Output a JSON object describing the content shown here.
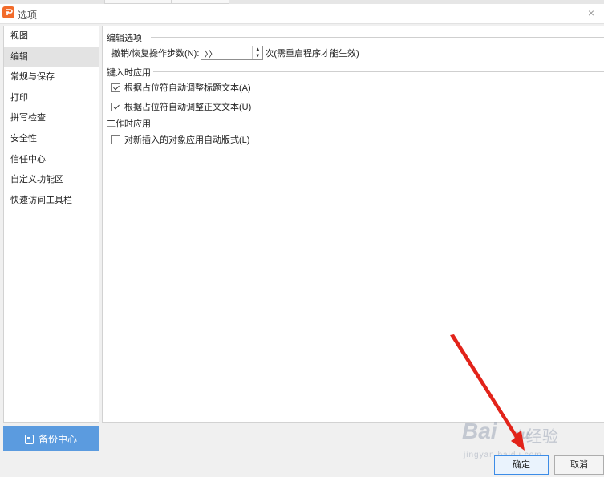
{
  "window": {
    "title": "选项",
    "close_glyph": "×",
    "logo_icon": "wps-logo-icon",
    "accent_color": "#f26b2a"
  },
  "sidebar": {
    "items": [
      {
        "label": "视图"
      },
      {
        "label": "编辑",
        "active": true
      },
      {
        "label": "常规与保存"
      },
      {
        "label": "打印"
      },
      {
        "label": "拼写检查"
      },
      {
        "label": "安全性"
      },
      {
        "label": "信任中心"
      },
      {
        "label": "自定义功能区"
      },
      {
        "label": "快速访问工具栏"
      }
    ]
  },
  "content": {
    "edit_options": {
      "header": "编辑选项",
      "undo_label": "撤销/恢复操作步数(N):",
      "undo_value": "〉〉",
      "undo_suffix": "次(需重启程序才能生效)"
    },
    "typing_apply": {
      "header": "键入时应用",
      "options": [
        {
          "label": "根据占位符自动调整标题文本(A)",
          "checked": true
        },
        {
          "label": "根据占位符自动调整正文文本(U)",
          "checked": true
        }
      ]
    },
    "work_apply": {
      "header": "工作时应用",
      "options": [
        {
          "label": "对新插入的对象应用自动版式(L)",
          "checked": false
        }
      ]
    }
  },
  "footer": {
    "backup_label": "备份中心",
    "backup_color": "#5b9bdf",
    "ok_label": "确定",
    "cancel_label": "取消"
  },
  "watermark": {
    "text_main": "Bai",
    "text_du": "du",
    "text_cn": "经验",
    "sub": "jingyan.baidu.com"
  },
  "annotation": {
    "arrow_color": "#e2231a"
  }
}
